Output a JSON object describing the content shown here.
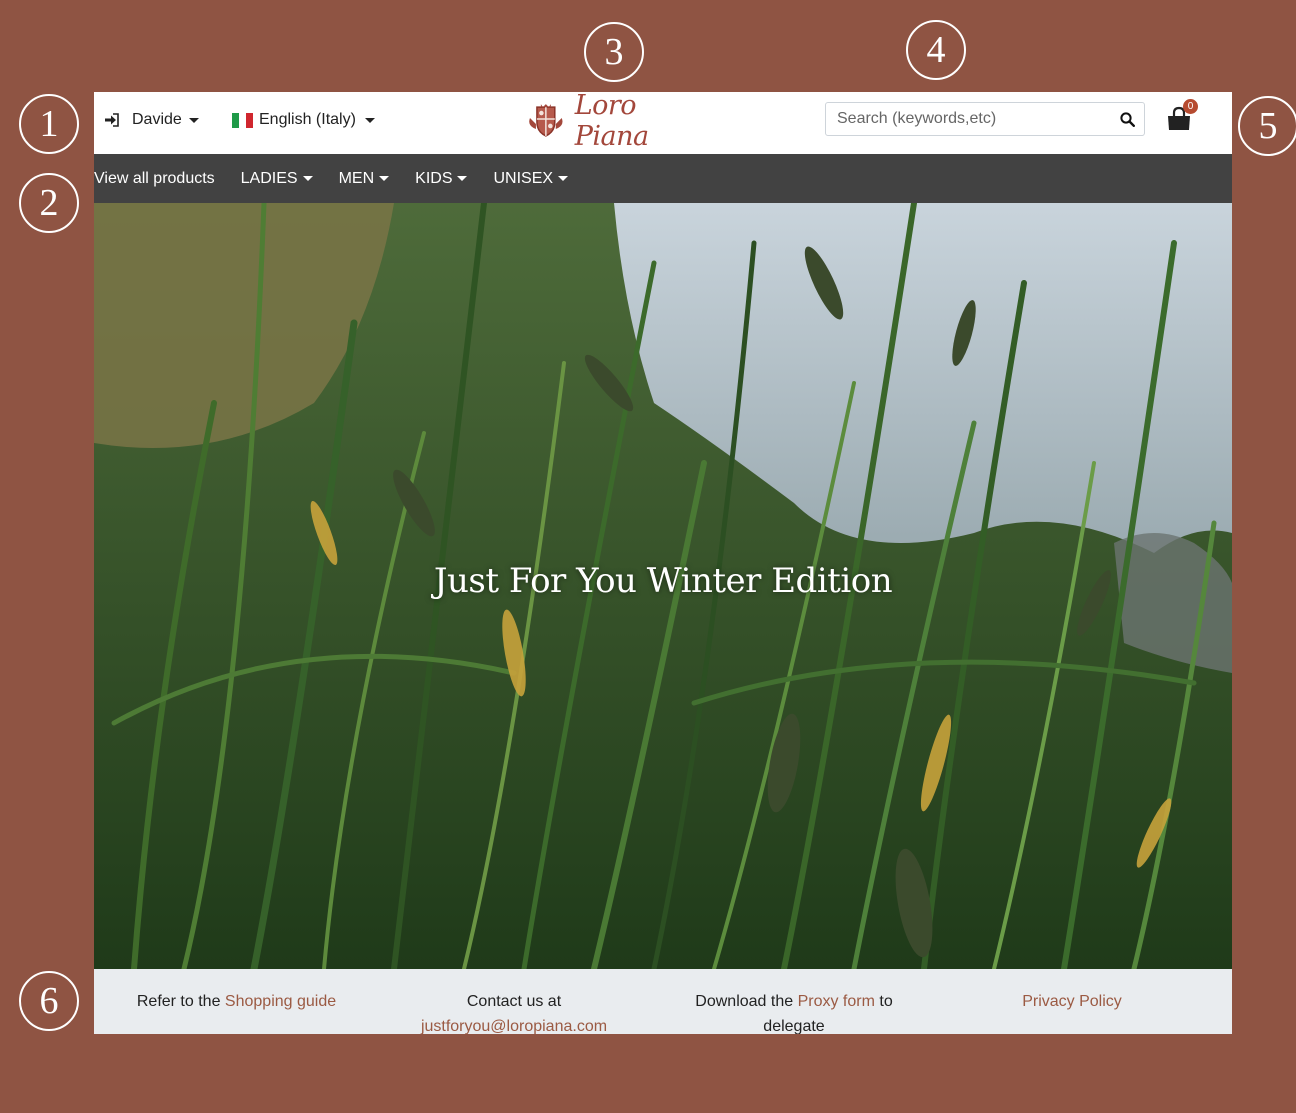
{
  "callouts": [
    "1",
    "2",
    "3",
    "4",
    "5",
    "6"
  ],
  "header": {
    "user_name": "Davide",
    "language": "English (Italy)",
    "brand": "Loro Piana",
    "search_placeholder": "Search (keywords,etc)",
    "cart_count": "0"
  },
  "nav": {
    "items": [
      {
        "label": "View all products",
        "has_dropdown": false
      },
      {
        "label": "LADIES",
        "has_dropdown": true
      },
      {
        "label": "MEN",
        "has_dropdown": true
      },
      {
        "label": "KIDS",
        "has_dropdown": true
      },
      {
        "label": "UNISEX",
        "has_dropdown": true
      }
    ]
  },
  "hero": {
    "title": "Just For You Winter Edition"
  },
  "footer": {
    "shopping_prefix": "Refer to the",
    "shopping_link": "Shopping guide",
    "contact_prefix": "Contact us at",
    "contact_email": "justforyou@loropiana.com",
    "proxy_prefix": "Download the",
    "proxy_link": "Proxy form",
    "proxy_suffix": "to",
    "proxy_line2": "delegate",
    "privacy_link": "Privacy Policy"
  },
  "colors": {
    "frame_background": "#8f5443",
    "navbar": "#424242",
    "footer_background": "#e9ecef",
    "brand_red": "#a3473b",
    "link": "#9b5a43",
    "cart_badge": "#b64b30"
  },
  "icons": [
    "login-icon",
    "italy-flag-icon",
    "loro-piana-crest-icon",
    "search-icon",
    "shopping-bag-icon"
  ]
}
